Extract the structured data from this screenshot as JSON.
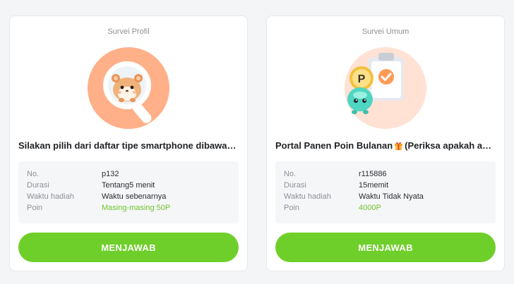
{
  "cards": [
    {
      "category": "Survei Profil",
      "illustration": "hamster-magnifier-icon",
      "title": "Silakan pilih dari daftar tipe smartphone dibawah i...",
      "details": [
        {
          "label": "No.",
          "value": "p132"
        },
        {
          "label": "Durasi",
          "value": "Tentang5 menit"
        },
        {
          "label": "Waktu hadiah",
          "value": "Waktu sebenarnya"
        },
        {
          "label": "Poin",
          "value": "Masing-masing 50P"
        }
      ],
      "button": "MENJAWAB"
    },
    {
      "category": "Survei Umum",
      "illustration": "clipboard-coin-mascot-icon",
      "title_before_icon": "Portal Panen Poin Bulanan",
      "title_icon": "gift-icon",
      "title_after_icon": "(Periksa apakah ada...",
      "details": [
        {
          "label": "No.",
          "value": "r115886"
        },
        {
          "label": "Durasi",
          "value": "15memit"
        },
        {
          "label": "Waktu hadiah",
          "value": "Waktu Tidak Nyata"
        },
        {
          "label": "Poin",
          "value": "4000P"
        }
      ],
      "button": "MENJAWAB"
    }
  ],
  "colors": {
    "accent_green": "#6fcf2a",
    "points_green": "#6fc62b",
    "illus_bg_1": "#ffb089",
    "illus_bg_2": "#ffe2d4"
  }
}
